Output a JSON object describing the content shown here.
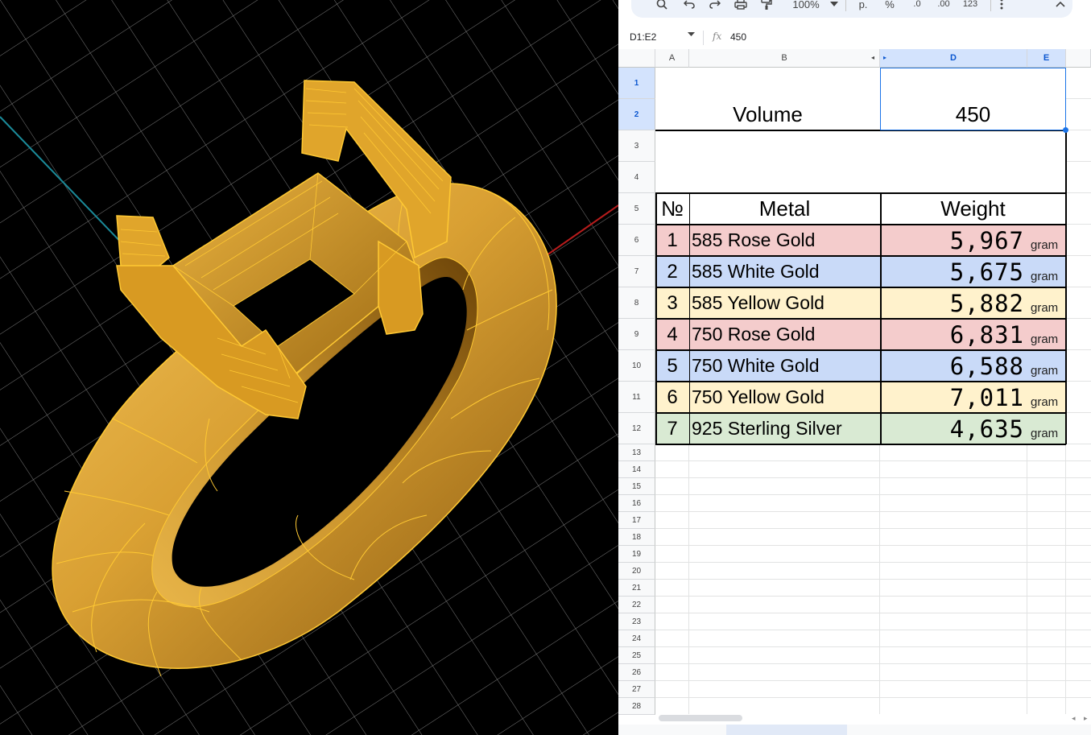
{
  "toolbar": {
    "zoom": "100%",
    "currency": "р.",
    "percent": "%",
    "dec_decrease": ".0",
    "dec_increase": ".00",
    "format_123": "123"
  },
  "formula_bar": {
    "name_box": "D1:E2",
    "fx_label": "fx",
    "value": "450"
  },
  "columns": [
    "A",
    "B",
    "D",
    "E"
  ],
  "rows": [
    "1",
    "2",
    "3",
    "4",
    "5",
    "6",
    "7",
    "8",
    "9",
    "10",
    "11",
    "12",
    "13",
    "14",
    "15",
    "16",
    "17",
    "18",
    "19",
    "20",
    "21",
    "22",
    "23",
    "24",
    "25",
    "26",
    "27",
    "28"
  ],
  "sheet": {
    "volume_label": "Volume",
    "volume_value": "450",
    "headers": {
      "num": "№",
      "metal": "Metal",
      "weight": "Weight"
    },
    "items": [
      {
        "num": "1",
        "metal": "585 Rose Gold",
        "weight": "5,967",
        "unit": "gram",
        "color": "#f4cccc"
      },
      {
        "num": "2",
        "metal": "585 White Gold",
        "weight": "5,675",
        "unit": "gram",
        "color": "#c9daf8"
      },
      {
        "num": "3",
        "metal": "585 Yellow Gold",
        "weight": "5,882",
        "unit": "gram",
        "color": "#fff2cc"
      },
      {
        "num": "4",
        "metal": "750 Rose Gold",
        "weight": "6,831",
        "unit": "gram",
        "color": "#f4cccc"
      },
      {
        "num": "5",
        "metal": "750 White Gold",
        "weight": "6,588",
        "unit": "gram",
        "color": "#c9daf8"
      },
      {
        "num": "6",
        "metal": "750 Yellow Gold",
        "weight": "7,011",
        "unit": "gram",
        "color": "#fff2cc"
      },
      {
        "num": "7",
        "metal": "925 Sterling Silver",
        "weight": "4,635",
        "unit": "gram",
        "color": "#d9ead3"
      }
    ]
  },
  "colors": {
    "ring_gold": "#e6a21a",
    "wire": "#ffc933",
    "axis_x": "#b81c1c",
    "axis_y": "#1b8a99",
    "selection": "#1a73e8"
  }
}
